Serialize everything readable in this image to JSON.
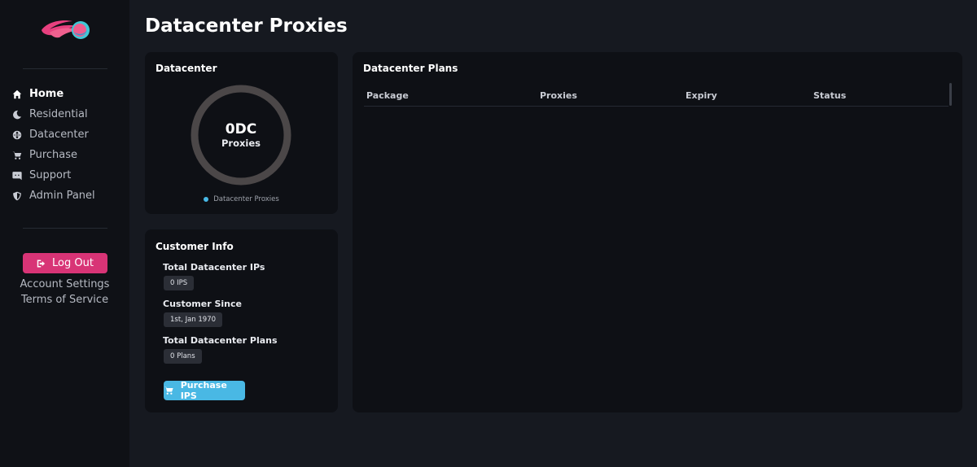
{
  "sidebar": {
    "nav": [
      {
        "label": "Home",
        "icon": "home-icon",
        "active": true
      },
      {
        "label": "Residential",
        "icon": "moon-icon",
        "active": false
      },
      {
        "label": "Datacenter",
        "icon": "globe-icon",
        "active": false
      },
      {
        "label": "Purchase",
        "icon": "cart-icon",
        "active": false
      },
      {
        "label": "Support",
        "icon": "discord-icon",
        "active": false
      },
      {
        "label": "Admin Panel",
        "icon": "shield-icon",
        "active": false
      }
    ],
    "logout_label": "Log Out",
    "account_settings_label": "Account Settings",
    "terms_label": "Terms of Service"
  },
  "page": {
    "title": "Datacenter Proxies"
  },
  "datacenter_card": {
    "title": "Datacenter",
    "donut_value": "0DC",
    "donut_label": "Proxies",
    "legend_label": "Datacenter Proxies",
    "legend_color": "#48b9e6",
    "ring_color": "#4b4748"
  },
  "customer_info": {
    "title": "Customer Info",
    "total_ips_label": "Total Datacenter IPs",
    "total_ips_value": "0 IPS",
    "customer_since_label": "Customer Since",
    "customer_since_value": "1st, Jan 1970",
    "total_plans_label": "Total Datacenter Plans",
    "total_plans_value": "0 Plans",
    "purchase_label": "Purchase IPS"
  },
  "plans": {
    "title": "Datacenter Plans",
    "columns": [
      "Package",
      "Proxies",
      "Expiry",
      "Status"
    ],
    "rows": []
  },
  "colors": {
    "accent_pink": "#d83476",
    "accent_blue": "#49b8e4",
    "background": "#161920",
    "card": "#0e1015"
  }
}
